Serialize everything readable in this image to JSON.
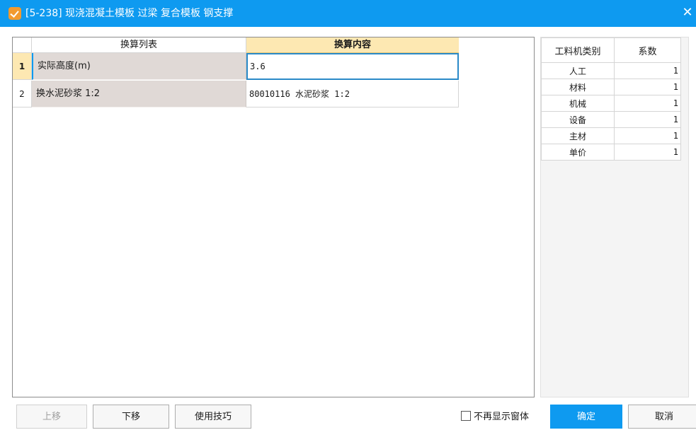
{
  "window": {
    "title": "[5-238] 现浇混凝土模板 过梁 复合模板 钢支撑",
    "accent_color": "#0e9af0",
    "icon": "app-logo-icon",
    "close_glyph": "✕"
  },
  "grid": {
    "headers": {
      "list": "换算列表",
      "content": "换算内容"
    },
    "rows": [
      {
        "num": "1",
        "name": "实际高度(m)",
        "value": "3.6"
      },
      {
        "num": "2",
        "name": "换水泥砂浆 1:2",
        "value": "80010116  水泥砂浆 1:2"
      }
    ]
  },
  "coefficients": {
    "headers": {
      "category": "工料机类别",
      "factor": "系数"
    },
    "rows": [
      {
        "category": "人工",
        "factor": "1"
      },
      {
        "category": "材料",
        "factor": "1"
      },
      {
        "category": "机械",
        "factor": "1"
      },
      {
        "category": "设备",
        "factor": "1"
      },
      {
        "category": "主材",
        "factor": "1"
      },
      {
        "category": "单价",
        "factor": "1"
      }
    ]
  },
  "footer": {
    "move_up": "上移",
    "move_down": "下移",
    "tips": "使用技巧",
    "dont_show": "不再显示窗体",
    "ok": "确定",
    "cancel": "取消"
  }
}
